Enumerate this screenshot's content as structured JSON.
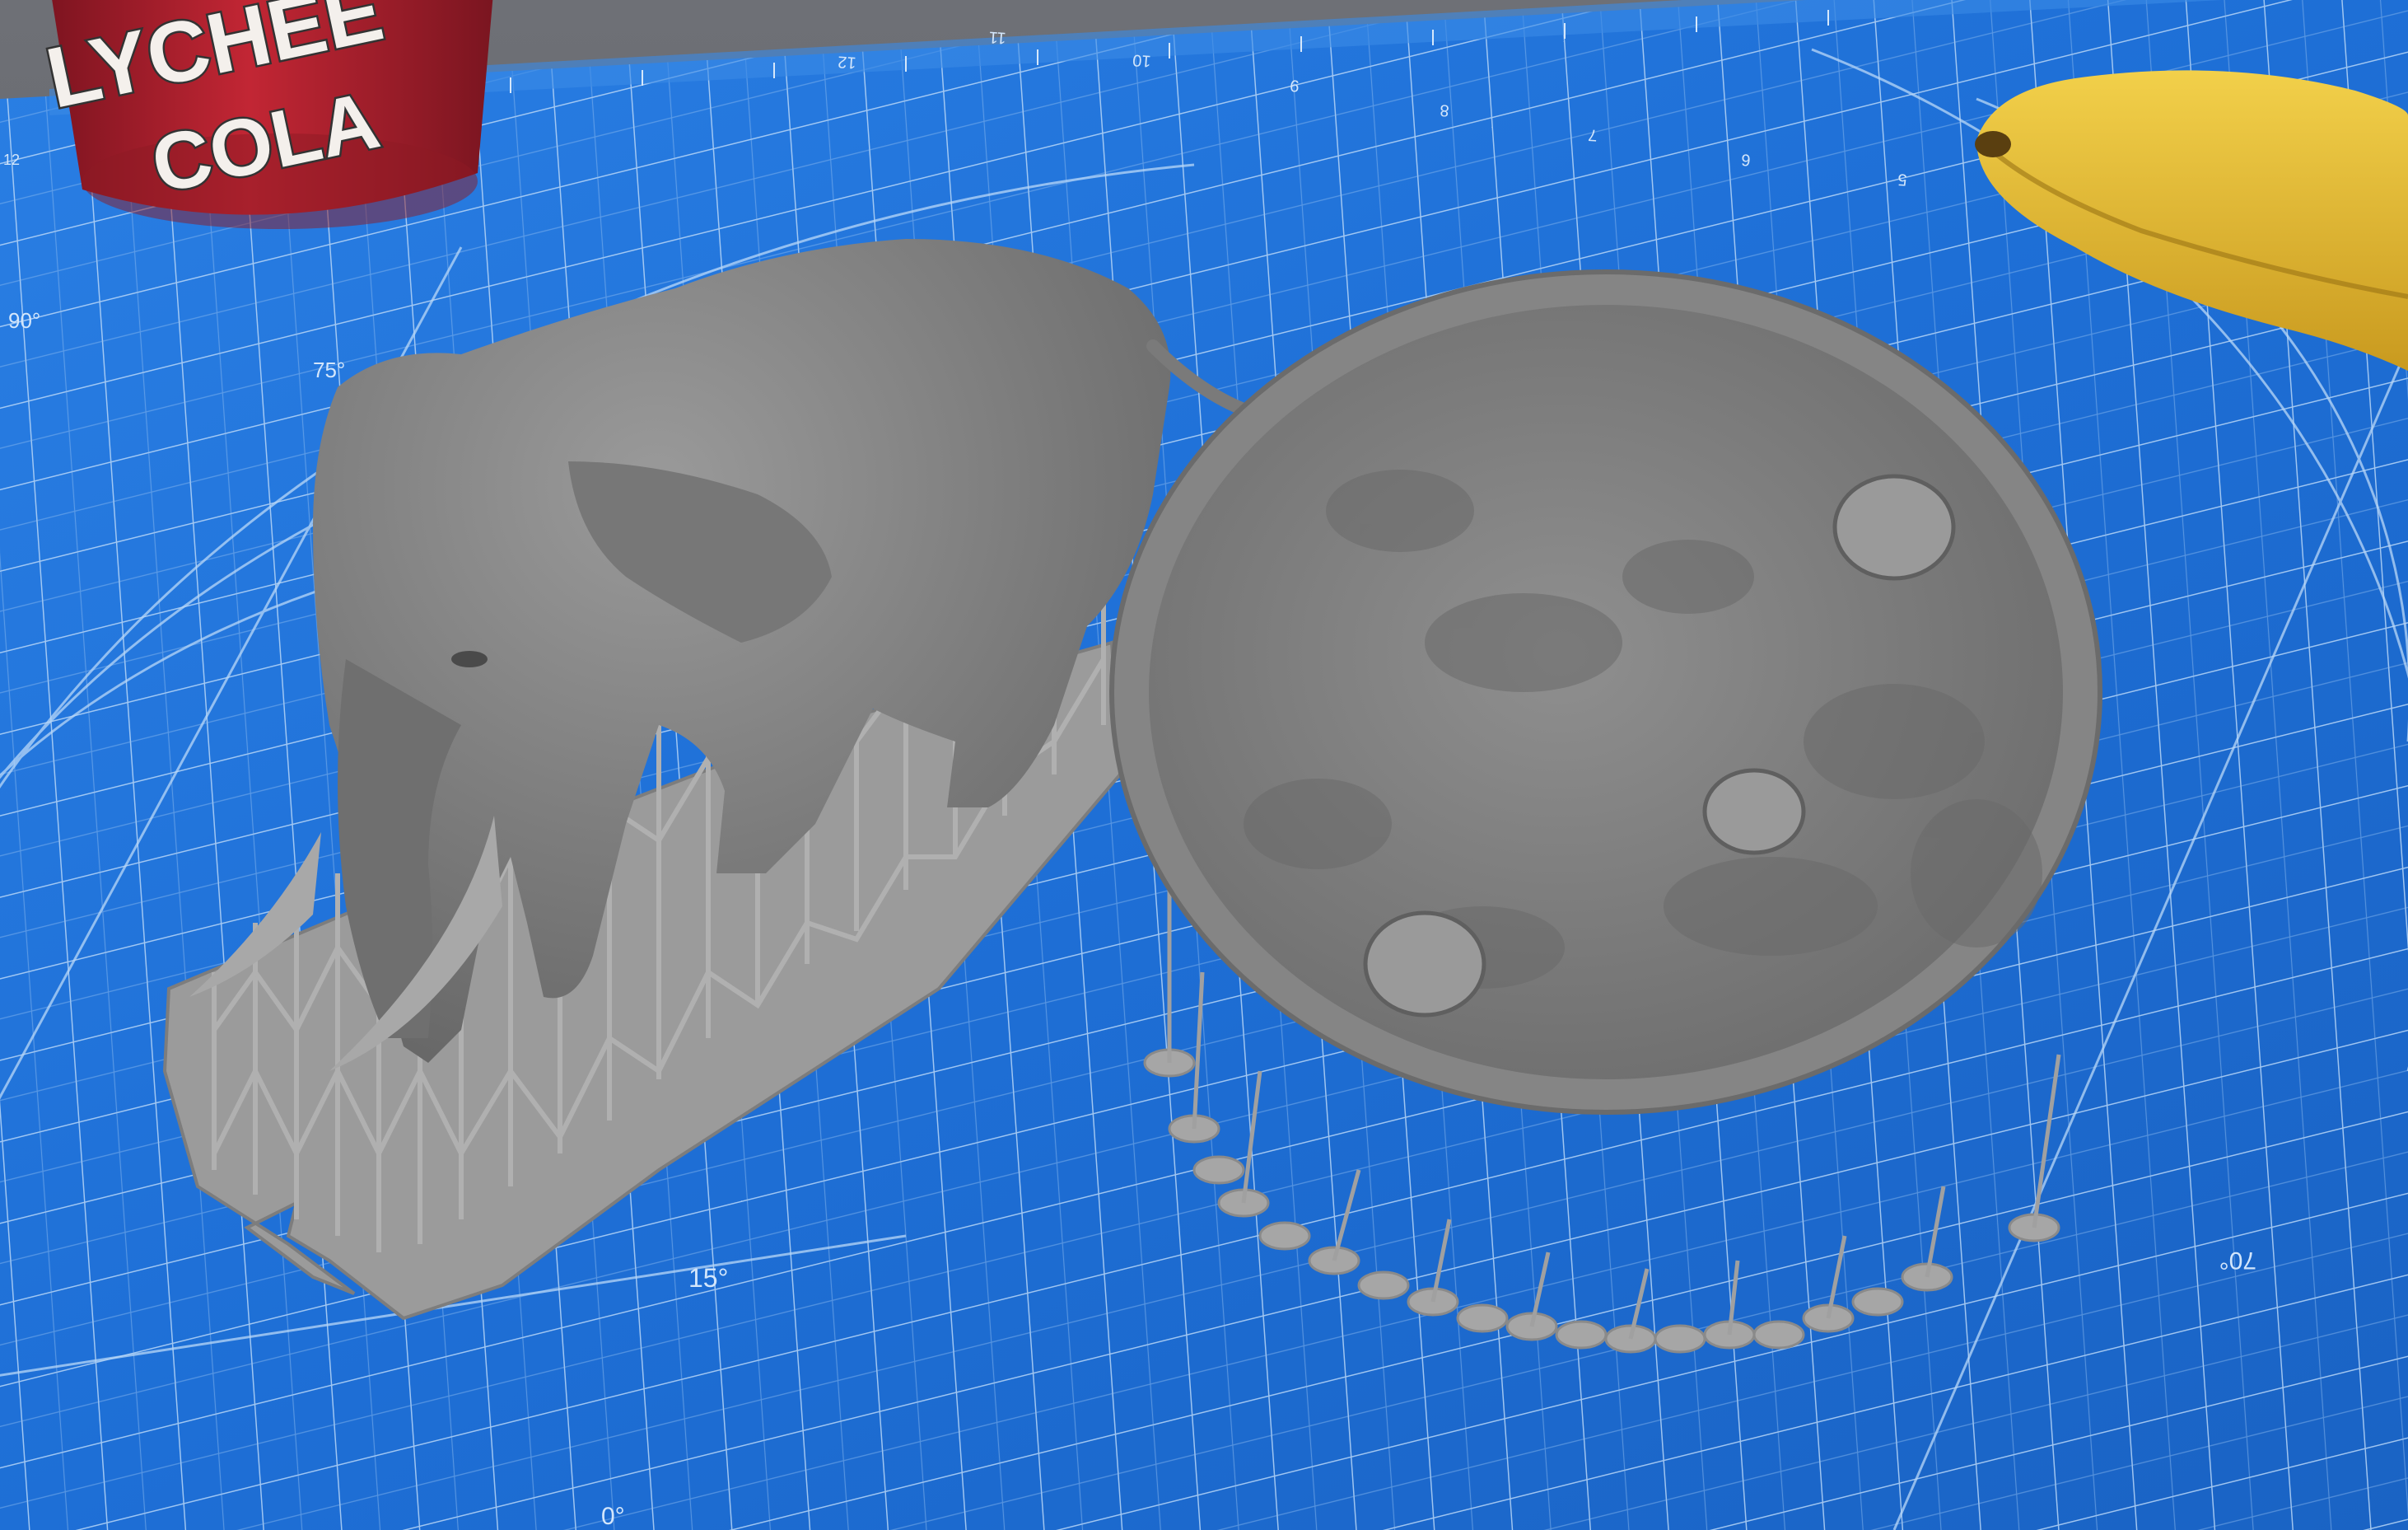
{
  "scene": {
    "colors": {
      "wall": "#6a6c72",
      "mat_blue": "#1f6fd8",
      "mat_line": "#9fc6f2",
      "model_gray": "#8c8c8c",
      "support_gray": "#a8a8a8",
      "can_red": "#b0202c",
      "banana_yellow": "#e8c23a"
    }
  },
  "can": {
    "label_line1": "LYCHEE",
    "label_line2": "COLA"
  },
  "mat": {
    "ruler_numbers": [
      "12",
      "11",
      "10",
      "9",
      "8",
      "7",
      "6",
      "5"
    ],
    "small_ruler_marks": [
      "r-7",
      "r-0",
      "r-6"
    ],
    "angle_labels": [
      "90°",
      "75°",
      "15°",
      "0°",
      "70°"
    ],
    "small_labels": [
      "12",
      "11",
      "10"
    ]
  },
  "models": {
    "elephant": {
      "icon": "elephant-model-icon"
    },
    "base": {
      "icon": "round-base-model-icon",
      "crater_count": 3
    }
  },
  "banana": {
    "icon": "banana-icon"
  }
}
